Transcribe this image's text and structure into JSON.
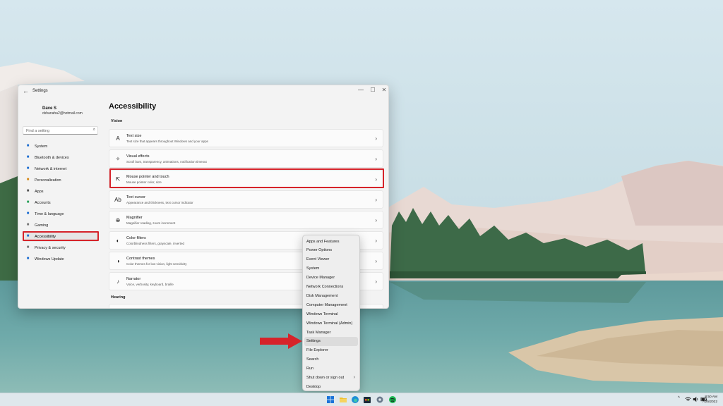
{
  "window": {
    "title": "Settings",
    "back_glyph": "←",
    "controls": {
      "minimize": "—",
      "maximize": "☐",
      "close": "✕"
    }
  },
  "user": {
    "name": "Dave S",
    "email": "dshanaha2@hotmail.com"
  },
  "search": {
    "placeholder": "Find a setting",
    "icon": "search-icon"
  },
  "sidebar": {
    "items": [
      {
        "label": "System",
        "icon": "monitor-icon",
        "color": "#1f6fd1"
      },
      {
        "label": "Bluetooth & devices",
        "icon": "bluetooth-icon",
        "color": "#1f6fd1"
      },
      {
        "label": "Network & internet",
        "icon": "network-icon",
        "color": "#1f6fd1"
      },
      {
        "label": "Personalization",
        "icon": "brush-icon",
        "color": "#d68a1c"
      },
      {
        "label": "Apps",
        "icon": "apps-icon",
        "color": "#555555"
      },
      {
        "label": "Accounts",
        "icon": "accounts-icon",
        "color": "#2aa15a"
      },
      {
        "label": "Time & language",
        "icon": "globe-icon",
        "color": "#1f6fd1"
      },
      {
        "label": "Gaming",
        "icon": "gamepad-icon",
        "color": "#777777"
      },
      {
        "label": "Accessibility",
        "icon": "accessibility-icon",
        "color": "#1f6fd1"
      },
      {
        "label": "Privacy & security",
        "icon": "shield-icon",
        "color": "#777777"
      },
      {
        "label": "Windows Update",
        "icon": "update-icon",
        "color": "#1f6fd1"
      }
    ],
    "active_index": 8
  },
  "main": {
    "title": "Accessibility",
    "section_vision": "Vision",
    "section_hearing": "Hearing",
    "cards": [
      {
        "title": "Text size",
        "subtitle": "Text size that appears throughout Windows and your apps",
        "icon": "text-size-icon",
        "glyph": "A"
      },
      {
        "title": "Visual effects",
        "subtitle": "Scroll bars, transparency, animations, notification timeout",
        "icon": "sparkle-icon",
        "glyph": "✧"
      },
      {
        "title": "Mouse pointer and touch",
        "subtitle": "Mouse pointer color, size",
        "icon": "mouse-pointer-icon",
        "glyph": "⇱"
      },
      {
        "title": "Text cursor",
        "subtitle": "Appearance and thickness, text cursor indicator",
        "icon": "text-cursor-icon",
        "glyph": "Ab"
      },
      {
        "title": "Magnifier",
        "subtitle": "Magnifier reading, zoom increment",
        "icon": "magnifier-icon",
        "glyph": "⊕"
      },
      {
        "title": "Color filters",
        "subtitle": "Colorblindness filters, grayscale, inverted",
        "icon": "color-filter-icon",
        "glyph": "◐"
      },
      {
        "title": "Contrast themes",
        "subtitle": "Color themes for low vision, light sensitivity",
        "icon": "contrast-icon",
        "glyph": "◑"
      },
      {
        "title": "Narrator",
        "subtitle": "Voice, verbosity, keyboard, braille",
        "icon": "narrator-icon",
        "glyph": "♪"
      }
    ],
    "chevron": "›"
  },
  "context_menu": {
    "items": [
      {
        "label": "Apps and Features"
      },
      {
        "label": "Power Options"
      },
      {
        "label": "Event Viewer"
      },
      {
        "label": "System"
      },
      {
        "label": "Device Manager"
      },
      {
        "label": "Network Connections"
      },
      {
        "label": "Disk Management"
      },
      {
        "label": "Computer Management"
      },
      {
        "label": "Windows Terminal"
      },
      {
        "label": "Windows Terminal (Admin)"
      },
      {
        "label": "Task Manager"
      },
      {
        "label": "Settings"
      },
      {
        "label": "File Explorer"
      },
      {
        "label": "Search"
      },
      {
        "label": "Run"
      },
      {
        "label": "Shut down or sign out",
        "submenu": "›"
      },
      {
        "label": "Desktop"
      }
    ],
    "hover_index": 11
  },
  "annotation": {
    "highlight_color": "#d6232a"
  },
  "taskbar": {
    "icons": [
      "start-icon",
      "file-explorer-icon",
      "edge-icon",
      "store-icon",
      "settings-icon",
      "spotify-icon"
    ],
    "tray": {
      "chevron": "^",
      "wifi": "wifi-icon",
      "volume": "volume-icon",
      "battery": "battery-icon"
    },
    "time": "8:50 AM",
    "date": "7/25/2022"
  }
}
